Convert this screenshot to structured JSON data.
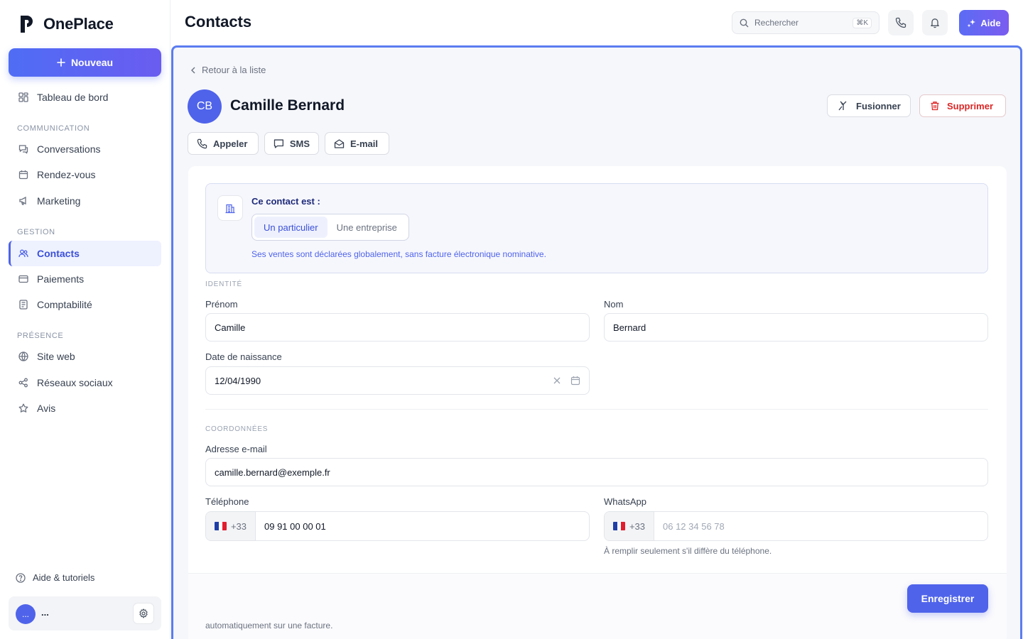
{
  "app": {
    "name": "OnePlace"
  },
  "sidebar": {
    "new_label": "Nouveau",
    "dashboard": "Tableau de bord",
    "sections": {
      "communication": "COMMUNICATION",
      "gestion": "GESTION",
      "presence": "PRÉSENCE"
    },
    "items": {
      "conversations": "Conversations",
      "rendezvous": "Rendez-vous",
      "marketing": "Marketing",
      "contacts": "Contacts",
      "paiements": "Paiements",
      "comptabilite": "Comptabilité",
      "site_web": "Site web",
      "reseaux": "Réseaux sociaux",
      "avis": "Avis"
    },
    "help": "Aide & tutoriels",
    "user": {
      "initials": "...",
      "name": "..."
    }
  },
  "header": {
    "title": "Contacts",
    "search_placeholder": "Rechercher",
    "search_shortcut": "⌘K",
    "help_label": "Aide"
  },
  "contact": {
    "back_label": "Retour à la liste",
    "initials": "CB",
    "full_name": "Camille Bernard",
    "merge_label": "Fusionner",
    "delete_label": "Supprimer",
    "call_label": "Appeler",
    "sms_label": "SMS",
    "email_label": "E-mail"
  },
  "contact_type": {
    "question": "Ce contact est :",
    "options": [
      "Un particulier",
      "Une entreprise"
    ],
    "selected": "Un particulier",
    "note": "Ses ventes sont déclarées globalement, sans facture électronique nominative."
  },
  "identity": {
    "section": "IDENTITÉ",
    "first_name_label": "Prénom",
    "first_name": "Camille",
    "last_name_label": "Nom",
    "last_name": "Bernard",
    "birth_label": "Date de naissance",
    "birth_date": "12/04/1990"
  },
  "coords": {
    "section": "COORDONNÉES",
    "email_label": "Adresse e-mail",
    "email": "camille.bernard@exemple.fr",
    "phone_label": "Téléphone",
    "phone_cc": "+33",
    "phone": "09 91 00 00 01",
    "whatsapp_label": "WhatsApp",
    "whatsapp_cc": "+33",
    "whatsapp_placeholder": "06 12 34 56 78",
    "whatsapp_hint": "À remplir seulement s'il diffère du téléphone."
  },
  "footer": {
    "partial_text": "automatiquement sur une facture.",
    "save_label": "Enregistrer"
  },
  "colors": {
    "accent": "#4f63ea",
    "danger": "#dc2626",
    "frame_border": "#5b7cf0"
  }
}
